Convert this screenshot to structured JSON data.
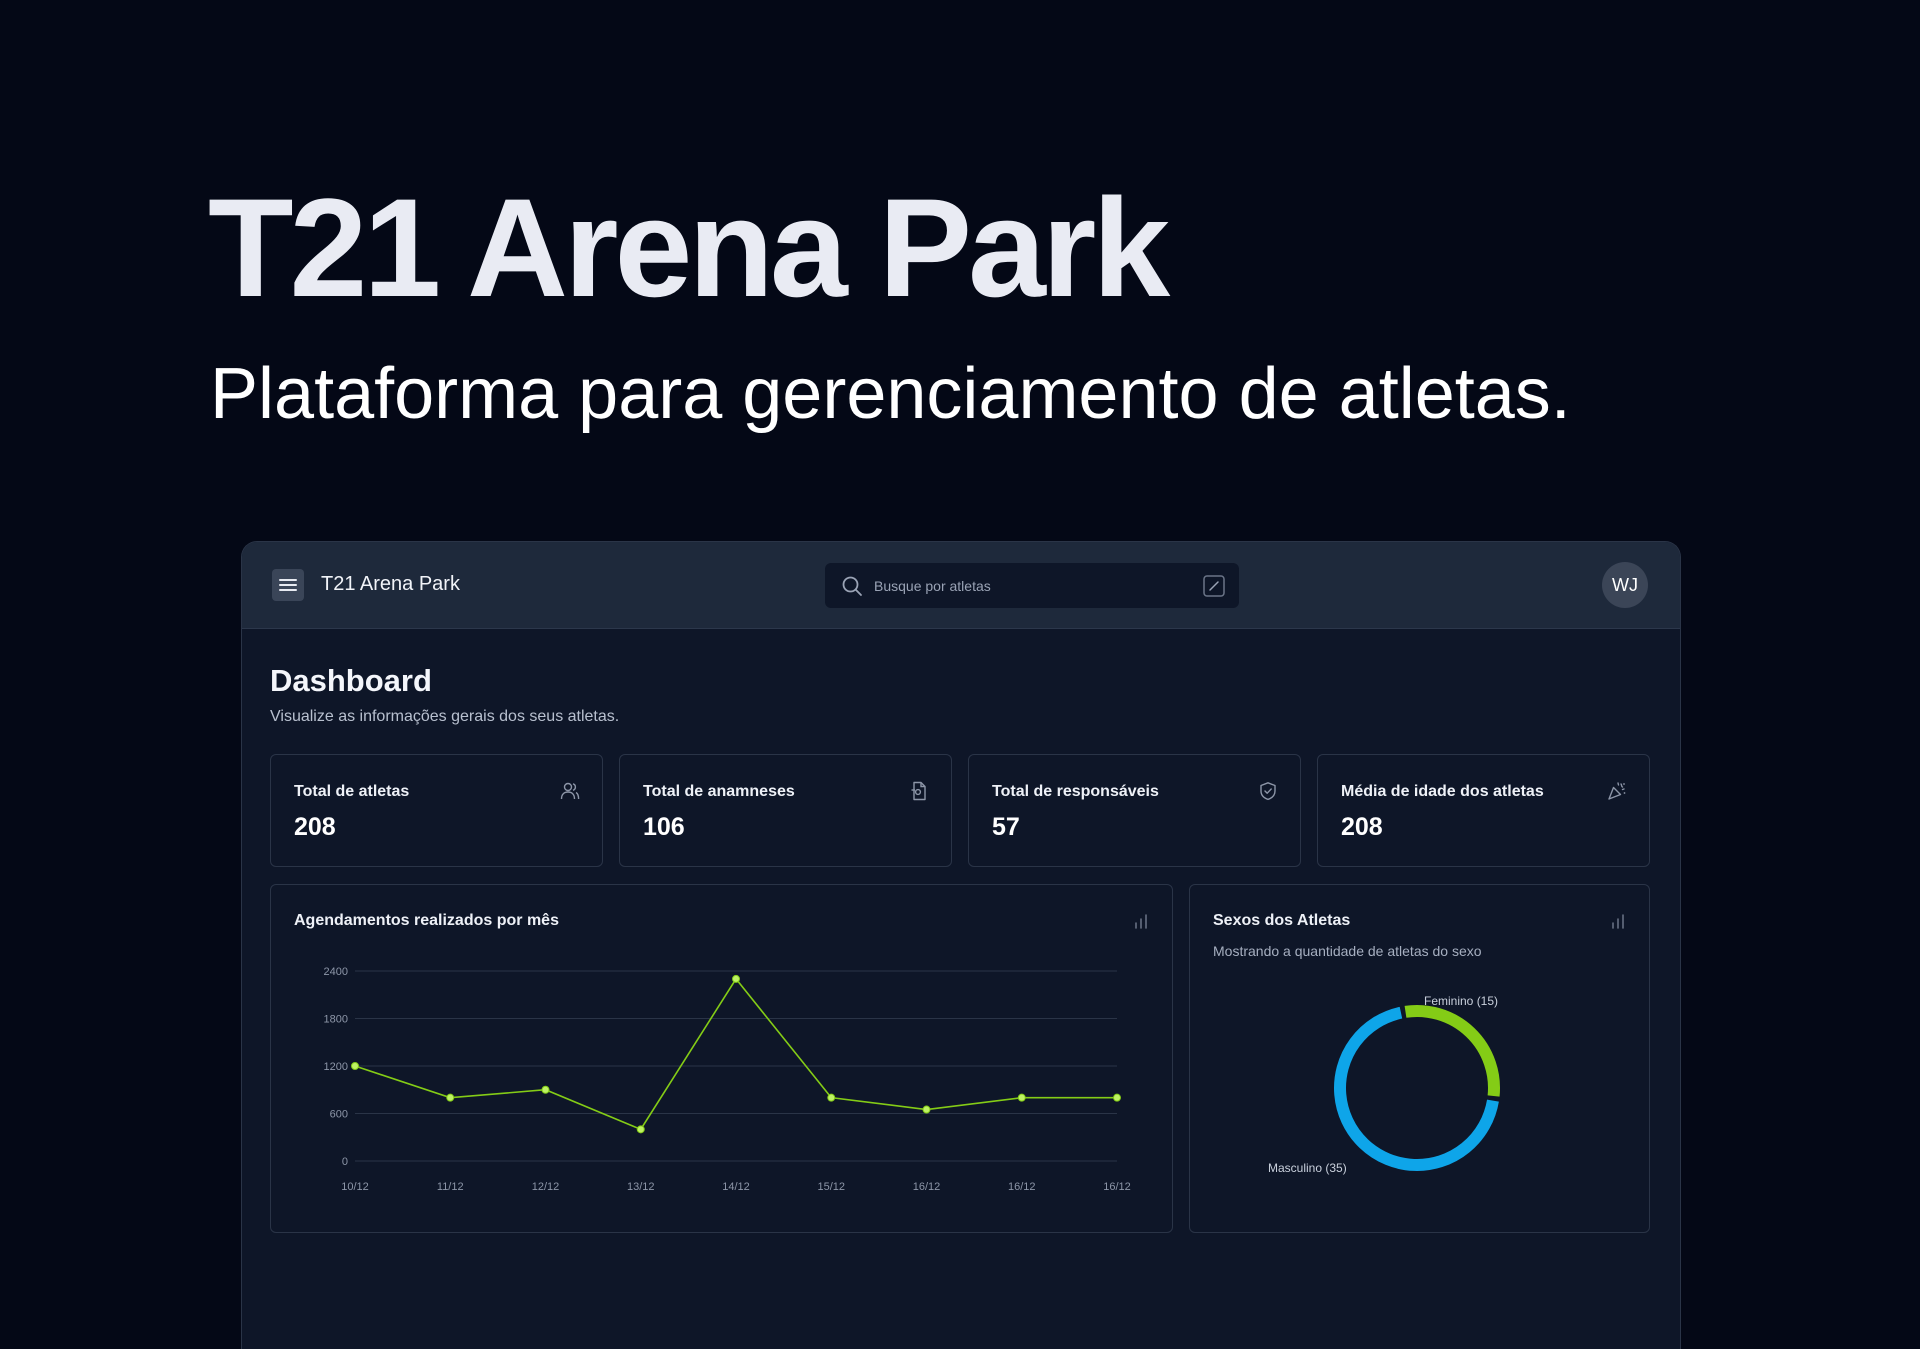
{
  "hero": {
    "title": "T21 Arena Park",
    "subtitle": "Plataforma para gerenciamento de atletas."
  },
  "topbar": {
    "app_name": "T21 Arena Park",
    "search_placeholder": "Busque por atletas",
    "avatar_initials": "WJ",
    "menu_icon": "hamburger-menu-icon",
    "search_icon": "search-icon",
    "edit_icon": "edit-icon"
  },
  "dashboard": {
    "title": "Dashboard",
    "description": "Visualize as informações gerais dos seus atletas."
  },
  "stats": [
    {
      "label": "Total de atletas",
      "value": "208",
      "icon": "users-icon"
    },
    {
      "label": "Total de anamneses",
      "value": "106",
      "icon": "document-icon"
    },
    {
      "label": "Total de responsáveis",
      "value": "57",
      "icon": "shield-icon"
    },
    {
      "label": "Média de idade dos atletas",
      "value": "208",
      "icon": "party-popper-icon"
    }
  ],
  "colors": {
    "background": "#040816",
    "panel": "#0e1628",
    "topbar": "#1e293b",
    "line_series": "#84cc16",
    "female": "#84cc16",
    "male": "#0ea5e9"
  },
  "chart_data": [
    {
      "type": "line",
      "title": "Agendamentos realizados por mês",
      "categories": [
        "10/12",
        "11/12",
        "12/12",
        "13/12",
        "14/12",
        "15/12",
        "16/12",
        "16/12",
        "16/12"
      ],
      "values": [
        1200,
        800,
        900,
        400,
        2300,
        800,
        650,
        800,
        800
      ],
      "yticks": [
        "2400",
        "1800",
        "1200",
        "600",
        "0"
      ],
      "ylim": [
        0,
        2400
      ],
      "grid": true
    },
    {
      "type": "pie",
      "title": "Sexos dos Atletas",
      "subtitle": "Mostrando a quantidade de atletas do sexo",
      "slices": [
        {
          "label": "Feminino (15)",
          "value": 15,
          "color": "#84cc16"
        },
        {
          "label": "Masculino (35)",
          "value": 35,
          "color": "#0ea5e9"
        }
      ]
    }
  ]
}
